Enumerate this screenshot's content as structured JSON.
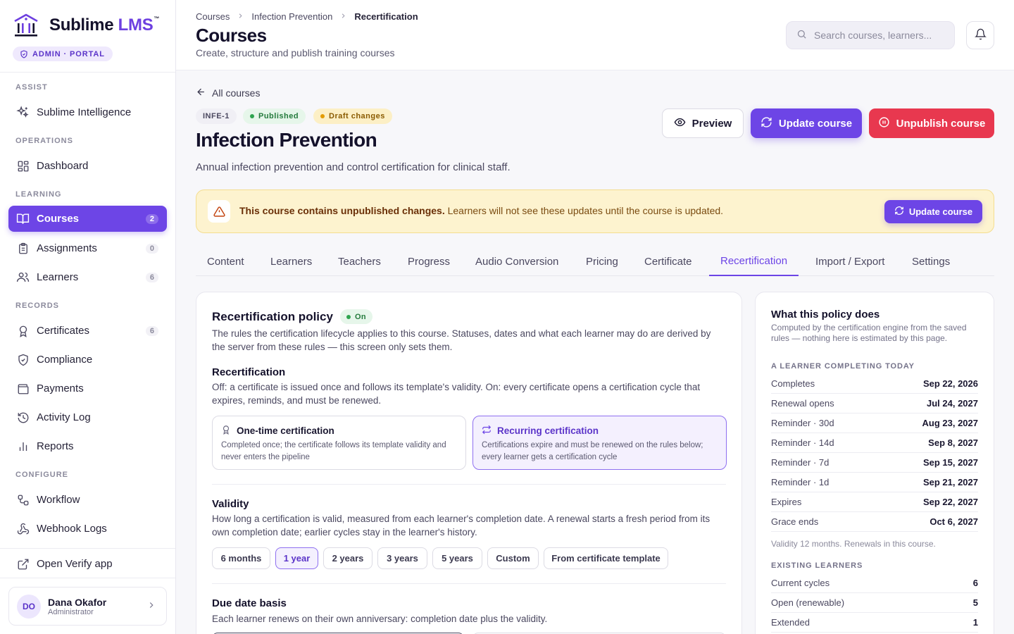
{
  "brand": {
    "name_main": "Sublime",
    "name_accent": "LMS",
    "tm": "™",
    "portal": "ADMIN · PORTAL"
  },
  "sidebar": {
    "sections": [
      {
        "label": "ASSIST"
      },
      {
        "label": "OPERATIONS"
      },
      {
        "label": "LEARNING"
      },
      {
        "label": "RECORDS"
      },
      {
        "label": "CONFIGURE"
      }
    ],
    "items": [
      {
        "label": "Sublime Intelligence",
        "icon": "sparkles-icon"
      },
      {
        "label": "Dashboard",
        "icon": "dashboard-icon"
      },
      {
        "label": "Courses",
        "icon": "book-icon",
        "count": "2"
      },
      {
        "label": "Assignments",
        "icon": "clipboard-icon",
        "count": "0"
      },
      {
        "label": "Learners",
        "icon": "users-icon",
        "count": "6"
      },
      {
        "label": "Certificates",
        "icon": "award-icon",
        "count": "6"
      },
      {
        "label": "Compliance",
        "icon": "shield-check-icon"
      },
      {
        "label": "Payments",
        "icon": "wallet-icon"
      },
      {
        "label": "Activity Log",
        "icon": "history-icon"
      },
      {
        "label": "Reports",
        "icon": "bar-chart-icon"
      },
      {
        "label": "Workflow",
        "icon": "workflow-icon"
      },
      {
        "label": "Webhook Logs",
        "icon": "webhook-icon"
      },
      {
        "label": "Open Verify app",
        "icon": "external-link-icon"
      }
    ],
    "user": {
      "initials": "DO",
      "name": "Dana Okafor",
      "role": "Administrator"
    }
  },
  "topbar": {
    "breadcrumbs": [
      "Courses",
      "Infection Prevention",
      "Recertification"
    ],
    "title": "Courses",
    "subtitle": "Create, structure and publish training courses",
    "search_placeholder": "Search courses, learners..."
  },
  "course": {
    "back": "All courses",
    "code": "INFE-1",
    "status_published": "Published",
    "status_draft": "Draft changes",
    "title": "Infection Prevention",
    "description": "Annual infection prevention and control certification for clinical staff.",
    "actions": {
      "preview": "Preview",
      "update": "Update course",
      "unpublish": "Unpublish course"
    }
  },
  "banner": {
    "strong": "This course contains unpublished changes.",
    "text": " Learners will not see these updates until the course is updated.",
    "button": "Update course"
  },
  "tabs": [
    "Content",
    "Learners",
    "Teachers",
    "Progress",
    "Audio Conversion",
    "Pricing",
    "Certificate",
    "Recertification",
    "Import / Export",
    "Settings"
  ],
  "active_tab": "Recertification",
  "policy": {
    "title": "Recertification policy",
    "state": "On",
    "intro": "The rules the certification lifecycle applies to this course. Statuses, dates and what each learner may do are derived by the server from these rules — this screen only sets them.",
    "recert": {
      "heading": "Recertification",
      "desc": "Off: a certificate is issued once and follows its template's validity. On: every certificate opens a certification cycle that expires, reminds, and must be renewed.",
      "options": [
        {
          "title": "One-time certification",
          "desc": "Completed once; the certificate follows its template validity and never enters the pipeline",
          "selected": false
        },
        {
          "title": "Recurring certification",
          "desc": "Certifications expire and must be renewed on the rules below; every learner gets a certification cycle",
          "selected": true
        }
      ]
    },
    "validity": {
      "heading": "Validity",
      "desc": "How long a certification is valid, measured from each learner's completion date. A renewal starts a fresh period from its own completion date; earlier cycles stay in the learner's history.",
      "options": [
        "6 months",
        "1 year",
        "2 years",
        "3 years",
        "5 years",
        "Custom",
        "From certificate template"
      ],
      "selected": "1 year"
    },
    "due": {
      "heading": "Due date basis",
      "desc": "Each learner renews on their own anniversary: completion date plus the validity."
    }
  },
  "summary": {
    "title": "What this policy does",
    "desc": "Computed by the certification engine from the saved rules — nothing here is estimated by this page.",
    "today_heading": "A LEARNER COMPLETING TODAY",
    "today_rows": [
      {
        "label": "Completes",
        "value": "Sep 22, 2026"
      },
      {
        "label": "Renewal opens",
        "value": "Jul 24, 2027"
      },
      {
        "label": "Reminder · 30d",
        "value": "Aug 23, 2027"
      },
      {
        "label": "Reminder · 14d",
        "value": "Sep 8, 2027"
      },
      {
        "label": "Reminder · 7d",
        "value": "Sep 15, 2027"
      },
      {
        "label": "Reminder · 1d",
        "value": "Sep 21, 2027"
      },
      {
        "label": "Expires",
        "value": "Sep 22, 2027"
      },
      {
        "label": "Grace ends",
        "value": "Oct 6, 2027"
      }
    ],
    "note": "Validity 12 months. Renewals in this course.",
    "existing_heading": "EXISTING LEARNERS",
    "existing_rows": [
      {
        "label": "Current cycles",
        "value": "6"
      },
      {
        "label": "Open (renewable)",
        "value": "5"
      },
      {
        "label": "Extended",
        "value": "1"
      }
    ]
  },
  "colors": {
    "accent": "#6d45e6",
    "danger": "#e8384f",
    "warning_bg": "#fdf3cf",
    "success": "#2ea44f"
  }
}
